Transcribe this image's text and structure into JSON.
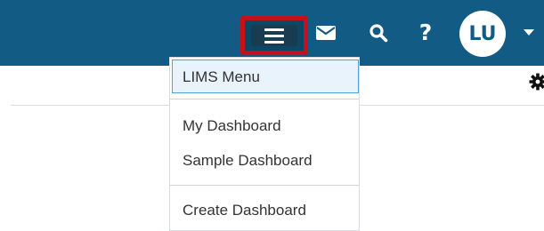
{
  "topbar": {
    "colors": {
      "bar": "#125b84",
      "highlight_border": "#c4101a"
    },
    "icons": [
      "menu-icon",
      "mail-icon",
      "search-icon",
      "help-icon"
    ],
    "help_label": "?",
    "avatar_initials": "LU"
  },
  "dropdown": {
    "items": [
      {
        "label": "LIMS Menu",
        "active": true
      },
      {
        "label": "My Dashboard"
      },
      {
        "label": "Sample Dashboard"
      },
      {
        "label": "Create Dashboard"
      }
    ]
  },
  "toolbar": {
    "icons": [
      "gear-icon"
    ]
  }
}
